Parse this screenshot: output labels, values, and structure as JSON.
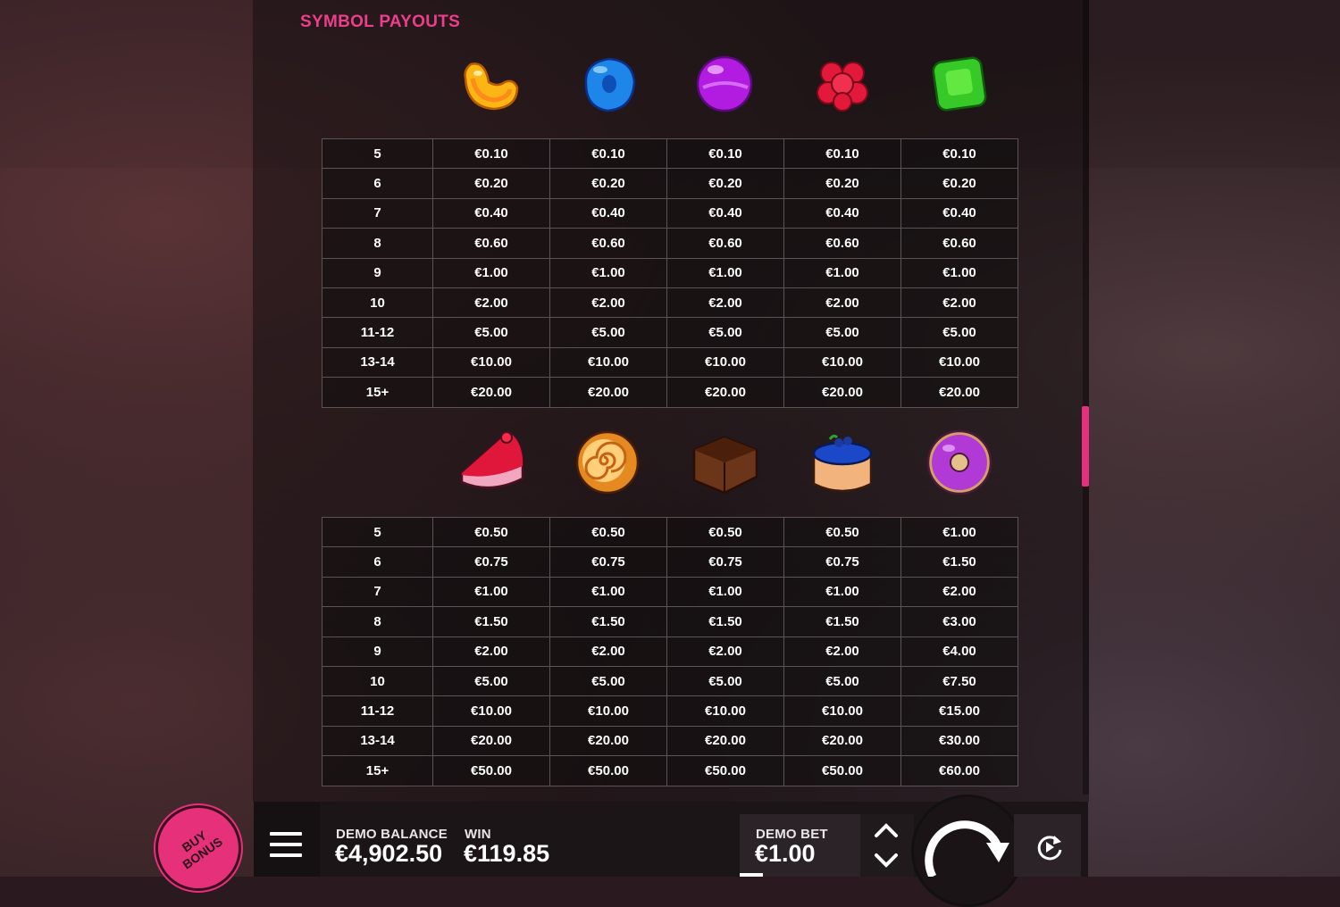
{
  "title": "SYMBOL PAYOUTS",
  "top_symbols": [
    "orange-slice-candy-icon",
    "blue-donut-candy-icon",
    "purple-lollipop-candy-icon",
    "red-raspberry-candy-icon",
    "green-gummy-candy-icon"
  ],
  "top_table": [
    [
      "5",
      "€0.10",
      "€0.10",
      "€0.10",
      "€0.10",
      "€0.10"
    ],
    [
      "6",
      "€0.20",
      "€0.20",
      "€0.20",
      "€0.20",
      "€0.20"
    ],
    [
      "7",
      "€0.40",
      "€0.40",
      "€0.40",
      "€0.40",
      "€0.40"
    ],
    [
      "8",
      "€0.60",
      "€0.60",
      "€0.60",
      "€0.60",
      "€0.60"
    ],
    [
      "9",
      "€1.00",
      "€1.00",
      "€1.00",
      "€1.00",
      "€1.00"
    ],
    [
      "10",
      "€2.00",
      "€2.00",
      "€2.00",
      "€2.00",
      "€2.00"
    ],
    [
      "11-12",
      "€5.00",
      "€5.00",
      "€5.00",
      "€5.00",
      "€5.00"
    ],
    [
      "13-14",
      "€10.00",
      "€10.00",
      "€10.00",
      "€10.00",
      "€10.00"
    ],
    [
      "15+",
      "€20.00",
      "€20.00",
      "€20.00",
      "€20.00",
      "€20.00"
    ]
  ],
  "bottom_symbols": [
    "cake-slice-icon",
    "swiss-roll-icon",
    "brownie-icon",
    "blueberry-cake-icon",
    "purple-donut-icon"
  ],
  "bottom_table": [
    [
      "5",
      "€0.50",
      "€0.50",
      "€0.50",
      "€0.50",
      "€1.00"
    ],
    [
      "6",
      "€0.75",
      "€0.75",
      "€0.75",
      "€0.75",
      "€1.50"
    ],
    [
      "7",
      "€1.00",
      "€1.00",
      "€1.00",
      "€1.00",
      "€2.00"
    ],
    [
      "8",
      "€1.50",
      "€1.50",
      "€1.50",
      "€1.50",
      "€3.00"
    ],
    [
      "9",
      "€2.00",
      "€2.00",
      "€2.00",
      "€2.00",
      "€4.00"
    ],
    [
      "10",
      "€5.00",
      "€5.00",
      "€5.00",
      "€5.00",
      "€7.50"
    ],
    [
      "11-12",
      "€10.00",
      "€10.00",
      "€10.00",
      "€10.00",
      "€15.00"
    ],
    [
      "13-14",
      "€20.00",
      "€20.00",
      "€20.00",
      "€20.00",
      "€30.00"
    ],
    [
      "15+",
      "€50.00",
      "€50.00",
      "€50.00",
      "€50.00",
      "€60.00"
    ]
  ],
  "bottom_bar": {
    "buy_bonus_line1": "BUY",
    "buy_bonus_line2": "BONUS",
    "balance_label": "DEMO BALANCE",
    "balance_value": "€4,902.50",
    "win_label": "WIN",
    "win_value": "€119.85",
    "bet_label": "DEMO BET",
    "bet_value": "€1.00"
  },
  "colors": {
    "accent": "#e6317a",
    "title": "#ec3e8a"
  }
}
